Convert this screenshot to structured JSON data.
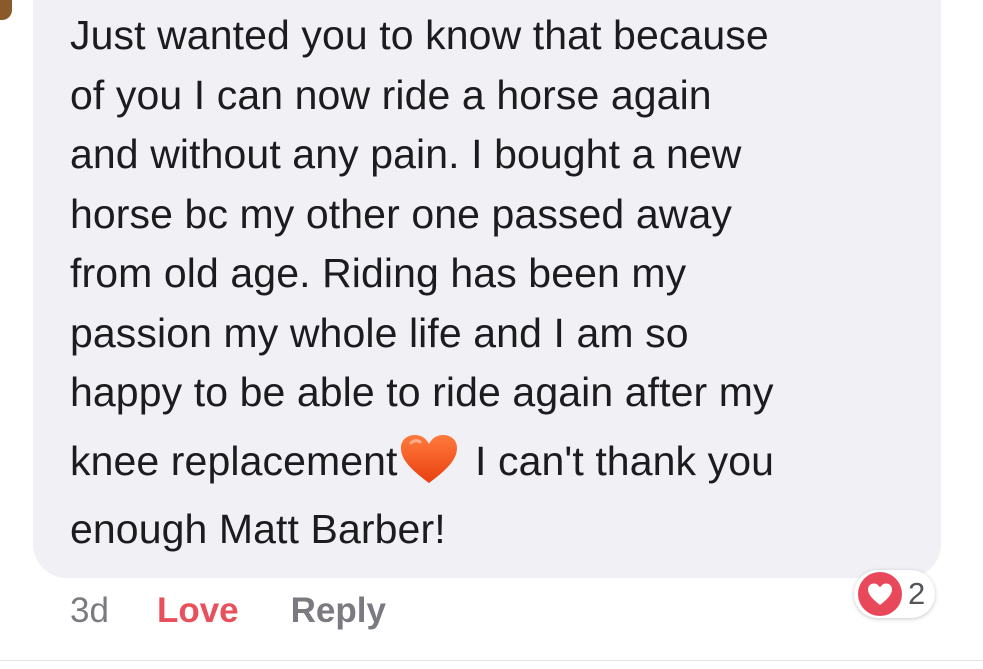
{
  "comment": {
    "lines": [
      "Just wanted you to know that because",
      "of you I can now ride a horse again",
      "and without any pain. I bought a new",
      "horse bc my other one passed away",
      "from old age. Riding has been my",
      "passion my whole life and I am so",
      "happy to be able to ride again after my"
    ],
    "emoji_line_before": "knee replacement",
    "emoji_line_after": " I can't thank you",
    "last_line": "enough Matt Barber!",
    "emoji": "orange-heart-icon"
  },
  "actions": {
    "time": "3d",
    "love_label": "Love",
    "reply_label": "Reply"
  },
  "reaction": {
    "icon": "heart-icon",
    "count": "2"
  },
  "colors": {
    "bubble": "#f0f0f5",
    "text": "#1c1c1e",
    "love": "#e8505b",
    "muted": "#7a7a80",
    "reaction": "#e9485a",
    "heart_emoji": "#f4511e"
  }
}
